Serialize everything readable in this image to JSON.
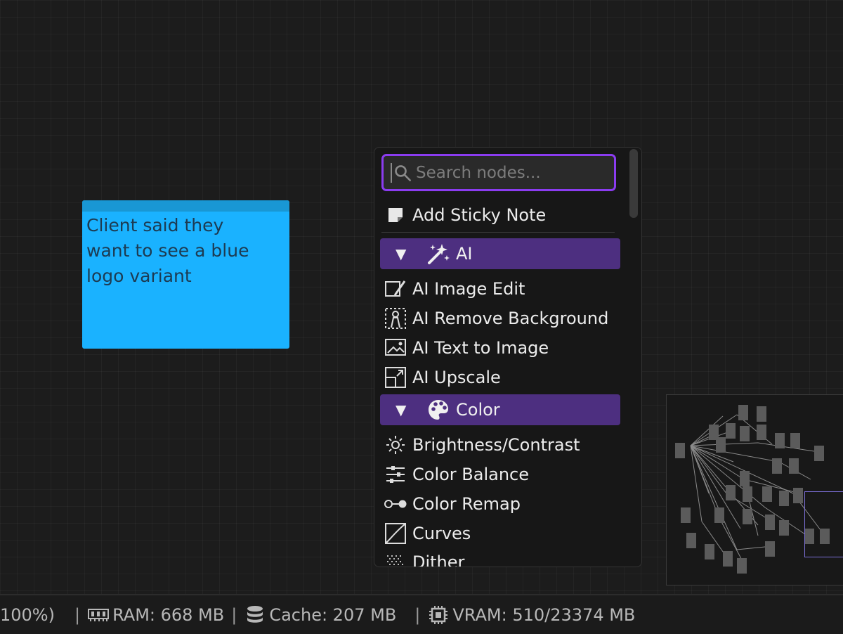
{
  "sticky_note": {
    "lines": [
      "Client said they",
      "want to see a blue",
      "logo variant"
    ],
    "color": "#1ab2ff"
  },
  "node_menu": {
    "search_placeholder": "Search nodes...",
    "add_sticky_label": "Add Sticky Note",
    "accent": "#8b3cf0",
    "categories": [
      {
        "label": "AI",
        "icon": "magic-wand-icon",
        "expanded": true,
        "items": [
          {
            "label": "AI Image Edit",
            "icon": "image-edit-icon"
          },
          {
            "label": "AI Remove Background",
            "icon": "remove-background-icon"
          },
          {
            "label": "AI Text to Image",
            "icon": "text-to-image-icon"
          },
          {
            "label": "AI Upscale",
            "icon": "upscale-icon"
          }
        ]
      },
      {
        "label": "Color",
        "icon": "palette-icon",
        "expanded": true,
        "items": [
          {
            "label": "Brightness/Contrast",
            "icon": "brightness-icon"
          },
          {
            "label": "Color Balance",
            "icon": "sliders-icon"
          },
          {
            "label": "Color Remap",
            "icon": "remap-icon"
          },
          {
            "label": "Curves",
            "icon": "curves-icon"
          },
          {
            "label": "Dither",
            "icon": "dither-icon"
          }
        ]
      }
    ]
  },
  "status_bar": {
    "zoom_fragment": "100%)",
    "ram": "RAM: 668 MB",
    "cache": "Cache: 207 MB",
    "vram": "VRAM: 510/23374 MB",
    "separator": "|"
  }
}
